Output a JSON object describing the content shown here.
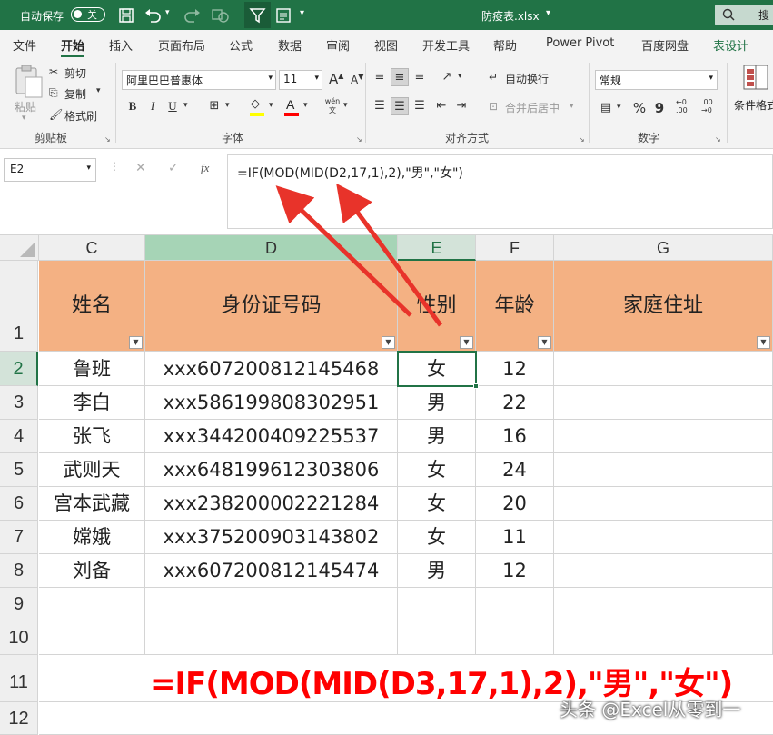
{
  "titlebar": {
    "autosave_label": "自动保存",
    "autosave_state": "关",
    "filename": "防疫表.xlsx",
    "search_label": "搜"
  },
  "menu": {
    "tabs": [
      "文件",
      "开始",
      "插入",
      "页面布局",
      "公式",
      "数据",
      "审阅",
      "视图",
      "开发工具",
      "帮助",
      "Power Pivot",
      "百度网盘",
      "表设计"
    ]
  },
  "ribbon": {
    "paste": "粘贴",
    "cut": "剪切",
    "copy": "复制",
    "format_painter": "格式刷",
    "clipboard_group": "剪贴板",
    "font_name": "阿里巴巴普惠体",
    "font_size": "11",
    "font_group": "字体",
    "wrap_text": "自动换行",
    "merge_center": "合并后居中",
    "align_group": "对齐方式",
    "number_format": "常规",
    "number_group": "数字",
    "conditional_format": "条件格式",
    "bold": "B",
    "italic": "I",
    "underline": "U",
    "wen": "wén 文",
    "percent": "%",
    "comma": "9"
  },
  "formula_bar": {
    "name_box": "E2",
    "fx": "fx",
    "formula": "=IF(MOD(MID(D2,17,1),2),\"男\",\"女\")"
  },
  "sheet": {
    "columns": [
      "C",
      "D",
      "E",
      "F",
      "G"
    ],
    "rows": [
      "1",
      "2",
      "3",
      "4",
      "5",
      "6",
      "7",
      "8",
      "9",
      "10",
      "11",
      "12"
    ],
    "headers": [
      "姓名",
      "身份证号码",
      "性别",
      "年龄",
      "家庭住址"
    ],
    "data": [
      [
        "鲁班",
        "xxx607200812145468",
        "女",
        "12",
        ""
      ],
      [
        "李白",
        "xxx586199808302951",
        "男",
        "22",
        ""
      ],
      [
        "张飞",
        "xxx344200409225537",
        "男",
        "16",
        ""
      ],
      [
        "武则天",
        "xxx648199612303806",
        "女",
        "24",
        ""
      ],
      [
        "宫本武藏",
        "xxx238200002221284",
        "女",
        "20",
        ""
      ],
      [
        "嫦娥",
        "xxx375200903143802",
        "女",
        "11",
        ""
      ],
      [
        "刘备",
        "xxx607200812145474",
        "男",
        "12",
        ""
      ]
    ],
    "selected_cell": "E2"
  },
  "annotation": {
    "formula_overlay": "=IF(MOD(MID(D3,17,1),2),\"男\",\"女\")",
    "watermark": "头条 @Excel从零到一",
    "arrow_color": "#e8332a"
  }
}
